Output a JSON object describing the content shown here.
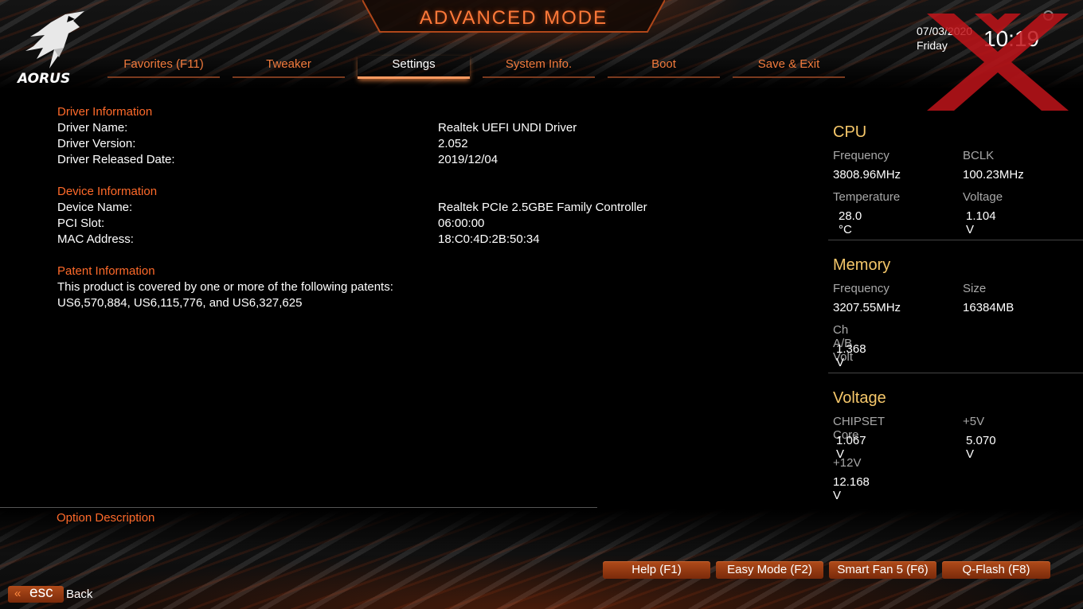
{
  "header": {
    "mode_title": "ADVANCED MODE",
    "logo_text": "AORUS",
    "date": "07/03/2020",
    "day": "Friday",
    "time": "10:19"
  },
  "tabs": [
    {
      "label": "Favorites (F11)",
      "active": false
    },
    {
      "label": "Tweaker",
      "active": false
    },
    {
      "label": "Settings",
      "active": true
    },
    {
      "label": "System Info.",
      "active": false
    },
    {
      "label": "Boot",
      "active": false
    },
    {
      "label": "Save & Exit",
      "active": false
    }
  ],
  "driver": {
    "title": "Driver Information",
    "name_label": "Driver Name:",
    "name_value": "Realtek UEFI UNDI Driver",
    "version_label": "Driver Version:",
    "version_value": "2.052",
    "date_label": "Driver Released Date:",
    "date_value": "2019/12/04"
  },
  "device": {
    "title": "Device Information",
    "name_label": "Device Name:",
    "name_value": "Realtek PCIe 2.5GBE Family Controller",
    "slot_label": "PCI Slot:",
    "slot_value": "06:00:00",
    "mac_label": "MAC Address:",
    "mac_value": "18:C0:4D:2B:50:34"
  },
  "patent": {
    "title": "Patent Information",
    "line1": "This product is covered by one or more of the following patents:",
    "line2": "US6,570,884, US6,115,776, and US6,327,625"
  },
  "option_description": {
    "label": "Option Description"
  },
  "cpu": {
    "title": "CPU",
    "frequency_label": "Frequency",
    "frequency_value": "3808.96MHz",
    "bclk_label": "BCLK",
    "bclk_value": "100.23MHz",
    "temperature_label": "Temperature",
    "temperature_value": "28.0 °C",
    "voltage_label": "Voltage",
    "voltage_value": "1.104 V"
  },
  "memory": {
    "title": "Memory",
    "frequency_label": "Frequency",
    "frequency_value": "3207.55MHz",
    "size_label": "Size",
    "size_value": "16384MB",
    "chab_label": "Ch A/B Volt",
    "chab_value": "1.368 V"
  },
  "voltage": {
    "title": "Voltage",
    "chipset_label": "CHIPSET Core",
    "chipset_value": "1.067 V",
    "p5v_label": "+5V",
    "p5v_value": "5.070 V",
    "p12v_label": "+12V",
    "p12v_value": "12.168 V"
  },
  "footer": {
    "help": "Help (F1)",
    "easy_mode": "Easy Mode (F2)",
    "smart_fan": "Smart Fan 5 (F6)",
    "qflash": "Q-Flash (F8)",
    "esc": "esc",
    "back": "Back"
  },
  "colors": {
    "accent_orange": "#ff6a2a",
    "panel_heading": "#f5c76a",
    "button_fill": "#9a3c12",
    "watermark_red": "#c0141a"
  },
  "icons": [
    "aorus-eagle-icon",
    "gear-icon",
    "double-chevron-left-icon"
  ]
}
